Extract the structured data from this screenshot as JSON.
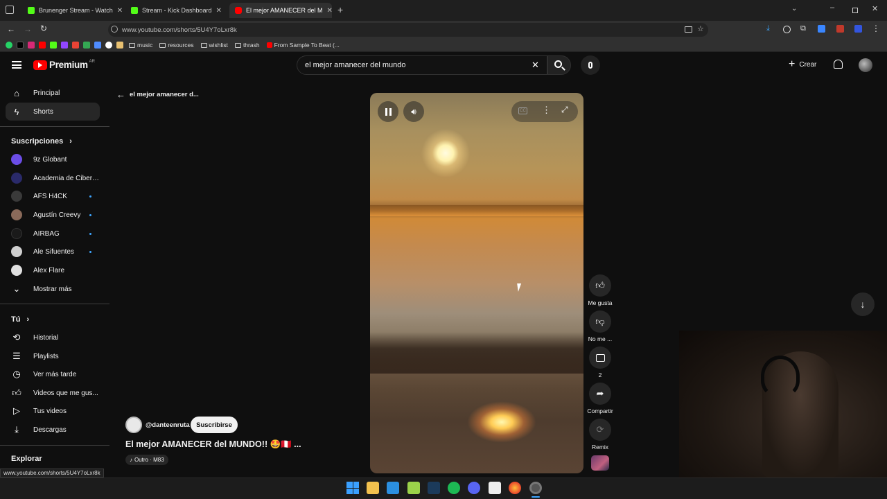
{
  "browser": {
    "tabs": [
      {
        "title": "Brunenger Stream - Watch",
        "icon": "kick-icon"
      },
      {
        "title": "Stream - Kick Dashboard",
        "icon": "kick-icon"
      },
      {
        "title": "El mejor AMANECER del M",
        "icon": "youtube-icon",
        "active": true
      }
    ],
    "url": "www.youtube.com/shorts/5U4Y7oLxr8k",
    "bookmarks": [
      "music",
      "resources",
      "wishlist",
      "thrash",
      "From Sample To Beat (..."
    ],
    "status_url": "www.youtube.com/shorts/5U4Y7oLxr8k"
  },
  "youtube": {
    "logo": "Premium",
    "region": "AR",
    "search_value": "el mejor amanecer del mundo",
    "create_label": "Crear"
  },
  "sidebar": {
    "main": [
      {
        "label": "Principal",
        "icon": "home-icon"
      },
      {
        "label": "Shorts",
        "icon": "shorts-icon",
        "selected": true
      }
    ],
    "subs_title": "Suscripciones",
    "subs": [
      {
        "label": "9z Globant",
        "color": "#6b4de6",
        "dot": false
      },
      {
        "label": "Academia de Ciber…",
        "color": "#2a2a6a",
        "dot": false
      },
      {
        "label": "AFS H4CK",
        "color": "#3a3a3a",
        "dot": true
      },
      {
        "label": "Agustín Creevy",
        "color": "#8a6a5a",
        "dot": true
      },
      {
        "label": "AIRBAG",
        "color": "#1a1a1a",
        "dot": true
      },
      {
        "label": "Ale Sifuentes",
        "color": "#cfcfcf",
        "dot": true
      },
      {
        "label": "Alex Flare",
        "color": "#e0e0e0",
        "dot": false
      }
    ],
    "more_label": "Mostrar más",
    "you_title": "Tú",
    "you": [
      {
        "label": "Historial",
        "icon": "history-icon"
      },
      {
        "label": "Playlists",
        "icon": "playlist-icon"
      },
      {
        "label": "Ver más tarde",
        "icon": "clock-icon"
      },
      {
        "label": "Videos que me gus...",
        "icon": "like-icon"
      },
      {
        "label": "Tus videos",
        "icon": "video-icon"
      },
      {
        "label": "Descargas",
        "icon": "download-icon"
      }
    ],
    "explore_title": "Explorar"
  },
  "shorts": {
    "back_label": "el mejor amanecer d...",
    "channel": "@danteenruta",
    "subscribe": "Suscribirse",
    "title": "El mejor AMANECER del MUNDO!! 🤩🇵🇪 ...",
    "music": "Outro · M83",
    "actions": {
      "like": "Me gusta",
      "dislike": "No me ...",
      "comments": "2",
      "share": "Compartir",
      "remix": "Remix"
    }
  },
  "colors": {
    "accent": "#3ea6ff",
    "youtube_red": "#ff0000",
    "background": "#0f0f0f"
  }
}
